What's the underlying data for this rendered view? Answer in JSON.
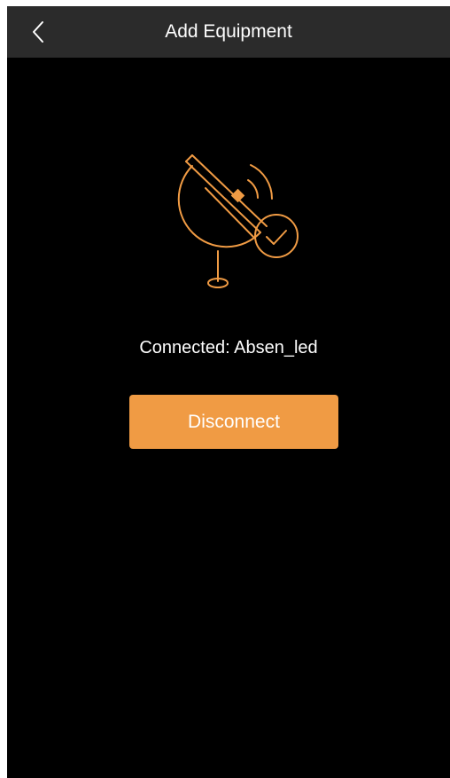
{
  "navbar": {
    "title": "Add Equipment",
    "back_icon": "chevron-left-icon"
  },
  "illustration": {
    "icon": "satellite-dish-connected-icon",
    "check_icon": "checkmark-circle-icon",
    "accent_color": "#f09b44"
  },
  "status": {
    "text": "Connected: Absen_led"
  },
  "actions": {
    "disconnect_label": "Disconnect"
  },
  "colors": {
    "background": "#000000",
    "navbar": "#2b2b2b",
    "accent": "#f09b44",
    "text": "#ffffff"
  }
}
